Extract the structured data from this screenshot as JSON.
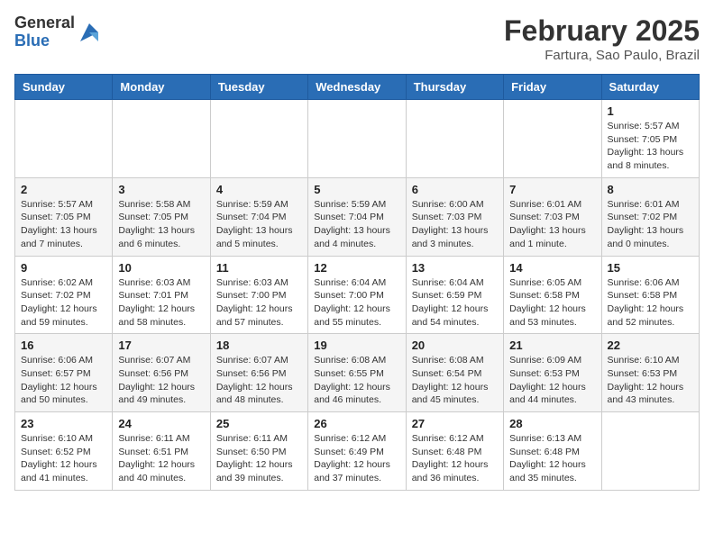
{
  "header": {
    "logo_general": "General",
    "logo_blue": "Blue",
    "month_title": "February 2025",
    "subtitle": "Fartura, Sao Paulo, Brazil"
  },
  "days_of_week": [
    "Sunday",
    "Monday",
    "Tuesday",
    "Wednesday",
    "Thursday",
    "Friday",
    "Saturday"
  ],
  "weeks": [
    [
      {
        "day": "",
        "info": ""
      },
      {
        "day": "",
        "info": ""
      },
      {
        "day": "",
        "info": ""
      },
      {
        "day": "",
        "info": ""
      },
      {
        "day": "",
        "info": ""
      },
      {
        "day": "",
        "info": ""
      },
      {
        "day": "1",
        "info": "Sunrise: 5:57 AM\nSunset: 7:05 PM\nDaylight: 13 hours and 8 minutes."
      }
    ],
    [
      {
        "day": "2",
        "info": "Sunrise: 5:57 AM\nSunset: 7:05 PM\nDaylight: 13 hours and 7 minutes."
      },
      {
        "day": "3",
        "info": "Sunrise: 5:58 AM\nSunset: 7:05 PM\nDaylight: 13 hours and 6 minutes."
      },
      {
        "day": "4",
        "info": "Sunrise: 5:59 AM\nSunset: 7:04 PM\nDaylight: 13 hours and 5 minutes."
      },
      {
        "day": "5",
        "info": "Sunrise: 5:59 AM\nSunset: 7:04 PM\nDaylight: 13 hours and 4 minutes."
      },
      {
        "day": "6",
        "info": "Sunrise: 6:00 AM\nSunset: 7:03 PM\nDaylight: 13 hours and 3 minutes."
      },
      {
        "day": "7",
        "info": "Sunrise: 6:01 AM\nSunset: 7:03 PM\nDaylight: 13 hours and 1 minute."
      },
      {
        "day": "8",
        "info": "Sunrise: 6:01 AM\nSunset: 7:02 PM\nDaylight: 13 hours and 0 minutes."
      }
    ],
    [
      {
        "day": "9",
        "info": "Sunrise: 6:02 AM\nSunset: 7:02 PM\nDaylight: 12 hours and 59 minutes."
      },
      {
        "day": "10",
        "info": "Sunrise: 6:03 AM\nSunset: 7:01 PM\nDaylight: 12 hours and 58 minutes."
      },
      {
        "day": "11",
        "info": "Sunrise: 6:03 AM\nSunset: 7:00 PM\nDaylight: 12 hours and 57 minutes."
      },
      {
        "day": "12",
        "info": "Sunrise: 6:04 AM\nSunset: 7:00 PM\nDaylight: 12 hours and 55 minutes."
      },
      {
        "day": "13",
        "info": "Sunrise: 6:04 AM\nSunset: 6:59 PM\nDaylight: 12 hours and 54 minutes."
      },
      {
        "day": "14",
        "info": "Sunrise: 6:05 AM\nSunset: 6:58 PM\nDaylight: 12 hours and 53 minutes."
      },
      {
        "day": "15",
        "info": "Sunrise: 6:06 AM\nSunset: 6:58 PM\nDaylight: 12 hours and 52 minutes."
      }
    ],
    [
      {
        "day": "16",
        "info": "Sunrise: 6:06 AM\nSunset: 6:57 PM\nDaylight: 12 hours and 50 minutes."
      },
      {
        "day": "17",
        "info": "Sunrise: 6:07 AM\nSunset: 6:56 PM\nDaylight: 12 hours and 49 minutes."
      },
      {
        "day": "18",
        "info": "Sunrise: 6:07 AM\nSunset: 6:56 PM\nDaylight: 12 hours and 48 minutes."
      },
      {
        "day": "19",
        "info": "Sunrise: 6:08 AM\nSunset: 6:55 PM\nDaylight: 12 hours and 46 minutes."
      },
      {
        "day": "20",
        "info": "Sunrise: 6:08 AM\nSunset: 6:54 PM\nDaylight: 12 hours and 45 minutes."
      },
      {
        "day": "21",
        "info": "Sunrise: 6:09 AM\nSunset: 6:53 PM\nDaylight: 12 hours and 44 minutes."
      },
      {
        "day": "22",
        "info": "Sunrise: 6:10 AM\nSunset: 6:53 PM\nDaylight: 12 hours and 43 minutes."
      }
    ],
    [
      {
        "day": "23",
        "info": "Sunrise: 6:10 AM\nSunset: 6:52 PM\nDaylight: 12 hours and 41 minutes."
      },
      {
        "day": "24",
        "info": "Sunrise: 6:11 AM\nSunset: 6:51 PM\nDaylight: 12 hours and 40 minutes."
      },
      {
        "day": "25",
        "info": "Sunrise: 6:11 AM\nSunset: 6:50 PM\nDaylight: 12 hours and 39 minutes."
      },
      {
        "day": "26",
        "info": "Sunrise: 6:12 AM\nSunset: 6:49 PM\nDaylight: 12 hours and 37 minutes."
      },
      {
        "day": "27",
        "info": "Sunrise: 6:12 AM\nSunset: 6:48 PM\nDaylight: 12 hours and 36 minutes."
      },
      {
        "day": "28",
        "info": "Sunrise: 6:13 AM\nSunset: 6:48 PM\nDaylight: 12 hours and 35 minutes."
      },
      {
        "day": "",
        "info": ""
      }
    ]
  ]
}
